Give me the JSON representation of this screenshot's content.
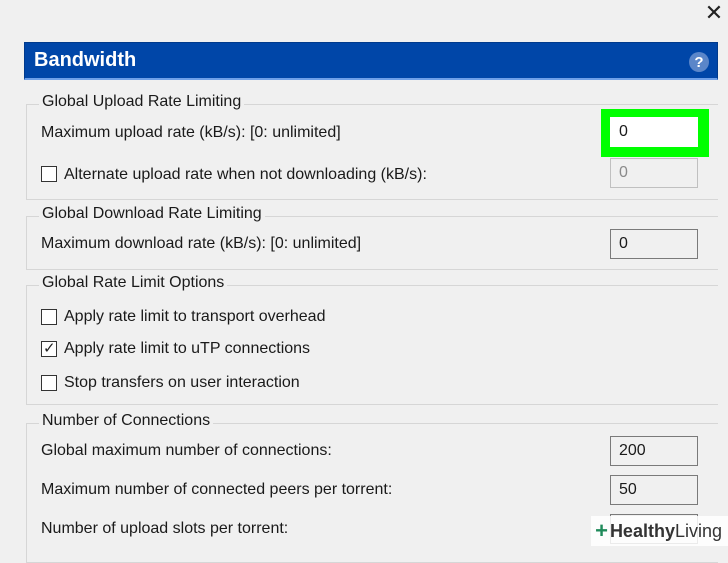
{
  "window": {
    "close_glyph": "✕"
  },
  "header": {
    "title": "Bandwidth",
    "help_glyph": "?"
  },
  "upload": {
    "title": "Global Upload Rate Limiting",
    "max_label": "Maximum upload rate (kB/s): [0: unlimited]",
    "max_value": "0",
    "alt_label": "Alternate upload rate when not downloading (kB/s):",
    "alt_value": "0"
  },
  "download": {
    "title": "Global Download Rate Limiting",
    "max_label": "Maximum download rate (kB/s): [0: unlimited]",
    "max_value": "0"
  },
  "options": {
    "title": "Global Rate Limit Options",
    "transport_label": "Apply rate limit to transport overhead",
    "utp_label": "Apply rate limit to uTP connections",
    "stop_label": "Stop transfers on user interaction"
  },
  "connections": {
    "title": "Number of Connections",
    "global_label": "Global maximum number of connections:",
    "global_value": "200",
    "peers_label": "Maximum number of connected peers per torrent:",
    "peers_value": "50",
    "slots_label": "Number of upload slots per torrent:"
  },
  "watermark": {
    "plus": "+",
    "bold": "Healthy",
    "text": " Living"
  },
  "accent": {
    "header_blue": "#0046a8",
    "highlight_green": "#00ff00"
  }
}
